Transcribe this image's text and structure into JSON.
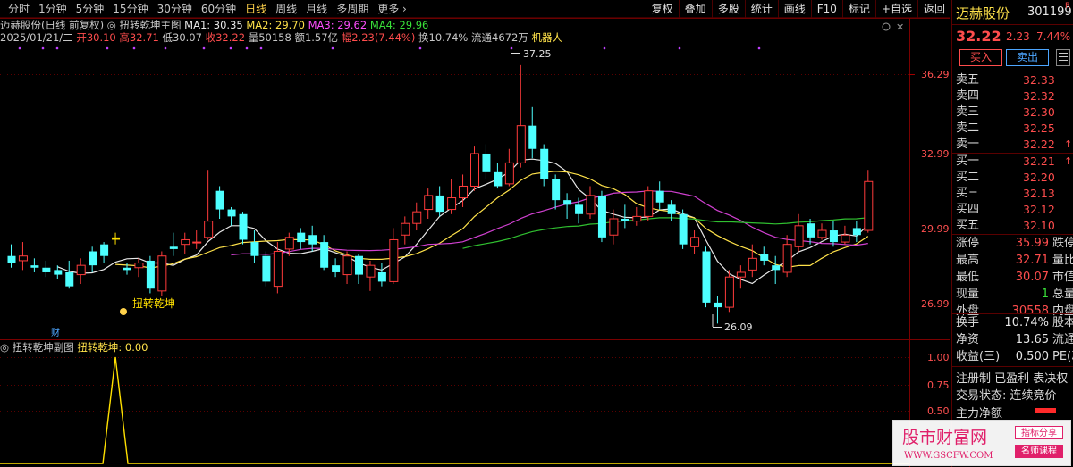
{
  "periods": [
    {
      "label": "分时",
      "active": false
    },
    {
      "label": "1分钟",
      "active": false
    },
    {
      "label": "5分钟",
      "active": false
    },
    {
      "label": "15分钟",
      "active": false
    },
    {
      "label": "30分钟",
      "active": false
    },
    {
      "label": "60分钟",
      "active": false
    },
    {
      "label": "日线",
      "active": true
    },
    {
      "label": "周线",
      "active": false
    },
    {
      "label": "月线",
      "active": false
    },
    {
      "label": "多周期",
      "active": false
    }
  ],
  "period_more": "更多 ›",
  "tools": [
    "复权",
    "叠加",
    "多股",
    "统计",
    "画线",
    "F10",
    "标记",
    "+自选",
    "返回"
  ],
  "main_header": {
    "stock": "迈赫股份(日线 前复权)",
    "indicator": "扭转乾坤主图",
    "ma1": "MA1: 30.35",
    "ma2": "MA2: 29.70",
    "ma3": "MA3: 29.62",
    "ma4": "MA4: 29.96"
  },
  "quote_line": {
    "date": "2025/01/21/二",
    "open": "开30.10",
    "high": "高32.71",
    "low": "低30.07",
    "close": "收32.22",
    "vol": "量50158",
    "amount": "额1.57亿",
    "range": "幅2.23(7.44%)",
    "turnover": "换10.74%",
    "float": "流通4672万",
    "robot": "机器人"
  },
  "price_axis": [
    "36.29",
    "32.99",
    "29.99",
    "26.99"
  ],
  "sub_axis": [
    "1.00",
    "0.75",
    "0.50"
  ],
  "annotations": {
    "high_label": "37.25",
    "low_label": "26.09",
    "signal_label": "扭转乾坤",
    "fin_marker": "财"
  },
  "sub_header": {
    "title": "扭转乾坤副图",
    "value": "扭转乾坤: 0.00"
  },
  "colors": {
    "up": "#ff3b3b",
    "down": "#4dffff",
    "ma1": "#e8e8e8",
    "ma2": "#ffe24a",
    "ma3": "#d040d0",
    "ma4": "#30c030",
    "signal": "#ffe000"
  },
  "chart_data": {
    "type": "candlestick",
    "ylim": [
      25.5,
      38.0
    ],
    "candles": [
      [
        29.0,
        28.7,
        29.5,
        28.5
      ],
      [
        28.8,
        29.0,
        29.6,
        28.4
      ],
      [
        28.6,
        28.5,
        28.9,
        28.3
      ],
      [
        28.5,
        28.3,
        28.8,
        28.1
      ],
      [
        28.4,
        28.2,
        28.6,
        28.0
      ],
      [
        28.3,
        27.7,
        28.8,
        27.6
      ],
      [
        28.2,
        28.6,
        28.9,
        27.8
      ],
      [
        29.2,
        28.6,
        29.4,
        28.3
      ],
      [
        29.5,
        29.0,
        29.6,
        28.7
      ],
      [
        29.7,
        29.8,
        30.0,
        29.5
      ],
      [
        28.5,
        28.4,
        28.7,
        28.2
      ],
      [
        28.5,
        28.7,
        28.9,
        28.1
      ],
      [
        28.8,
        27.6,
        29.0,
        27.4
      ],
      [
        27.5,
        29.0,
        29.2,
        27.3
      ],
      [
        29.4,
        29.3,
        30.0,
        29.0
      ],
      [
        29.5,
        29.7,
        30.0,
        29.1
      ],
      [
        29.6,
        29.6,
        30.1,
        29.3
      ],
      [
        29.8,
        30.5,
        32.7,
        29.7
      ],
      [
        31.8,
        31.0,
        32.0,
        30.6
      ],
      [
        31.0,
        30.7,
        31.1,
        30.3
      ],
      [
        30.8,
        29.7,
        30.9,
        29.5
      ],
      [
        29.6,
        29.0,
        30.1,
        28.7
      ],
      [
        29.0,
        27.9,
        29.2,
        27.7
      ],
      [
        27.7,
        29.2,
        29.6,
        27.4
      ],
      [
        29.3,
        29.8,
        30.0,
        29.0
      ],
      [
        30.0,
        29.6,
        30.2,
        29.3
      ],
      [
        29.9,
        29.5,
        30.3,
        29.2
      ],
      [
        29.6,
        28.5,
        29.9,
        28.4
      ],
      [
        28.6,
        28.3,
        28.9,
        28.1
      ],
      [
        28.2,
        29.0,
        29.2,
        27.8
      ],
      [
        29.0,
        28.2,
        29.1,
        27.8
      ],
      [
        28.1,
        28.6,
        28.8,
        27.5
      ],
      [
        28.3,
        27.9,
        28.7,
        27.7
      ],
      [
        27.9,
        29.7,
        30.2,
        27.8
      ],
      [
        29.9,
        30.4,
        30.7,
        29.5
      ],
      [
        30.4,
        30.9,
        31.3,
        30.1
      ],
      [
        31.0,
        31.6,
        31.9,
        30.6
      ],
      [
        31.6,
        30.9,
        32.0,
        30.7
      ],
      [
        31.0,
        31.5,
        32.3,
        30.8
      ],
      [
        31.5,
        32.0,
        32.5,
        31.1
      ],
      [
        32.0,
        33.4,
        33.7,
        31.8
      ],
      [
        33.4,
        32.6,
        33.8,
        32.3
      ],
      [
        32.6,
        32.0,
        33.0,
        31.9
      ],
      [
        32.1,
        33.0,
        33.6,
        32.0
      ],
      [
        33.0,
        34.6,
        37.2,
        32.8
      ],
      [
        34.6,
        33.6,
        35.4,
        33.2
      ],
      [
        33.6,
        32.3,
        33.8,
        32.0
      ],
      [
        32.3,
        31.4,
        32.5,
        31.0
      ],
      [
        31.4,
        31.2,
        31.7,
        30.6
      ],
      [
        31.2,
        30.8,
        31.5,
        30.4
      ],
      [
        30.8,
        31.6,
        32.0,
        30.6
      ],
      [
        31.6,
        29.8,
        31.8,
        29.6
      ],
      [
        29.9,
        30.6,
        31.0,
        29.5
      ],
      [
        30.6,
        30.5,
        31.2,
        30.2
      ],
      [
        30.5,
        30.7,
        31.1,
        30.3
      ],
      [
        30.7,
        31.8,
        32.0,
        30.5
      ],
      [
        31.8,
        31.3,
        32.2,
        31.0
      ],
      [
        31.2,
        30.8,
        31.4,
        30.5
      ],
      [
        30.8,
        29.5,
        31.0,
        29.3
      ],
      [
        29.4,
        29.8,
        30.1,
        29.1
      ],
      [
        29.2,
        27.0,
        29.4,
        26.8
      ],
      [
        27.0,
        26.8,
        27.3,
        26.1
      ],
      [
        26.8,
        28.1,
        28.4,
        26.6
      ],
      [
        28.1,
        28.3,
        28.6,
        27.6
      ],
      [
        28.4,
        28.9,
        29.5,
        28.1
      ],
      [
        29.1,
        28.8,
        29.4,
        28.6
      ],
      [
        28.6,
        28.4,
        29.0,
        27.8
      ],
      [
        28.3,
        29.5,
        29.9,
        28.1
      ],
      [
        29.4,
        30.3,
        30.8,
        29.2
      ],
      [
        30.4,
        29.8,
        30.6,
        29.5
      ],
      [
        29.8,
        30.1,
        30.4,
        29.7
      ],
      [
        30.1,
        29.6,
        30.5,
        29.4
      ],
      [
        29.6,
        29.9,
        30.3,
        29.5
      ],
      [
        30.2,
        29.9,
        30.5,
        29.6
      ],
      [
        30.1,
        32.2,
        32.7,
        30.0
      ]
    ],
    "signal_index": 9
  },
  "right_panel": {
    "name": "迈赫股份",
    "code": "301199",
    "tag": "R",
    "price": "32.22",
    "change": "2.23",
    "pct": "7.44%",
    "buy_label": "买入",
    "sell_label": "卖出",
    "asks": [
      {
        "label": "卖五",
        "price": "32.33"
      },
      {
        "label": "卖四",
        "price": "32.32"
      },
      {
        "label": "卖三",
        "price": "32.30"
      },
      {
        "label": "卖二",
        "price": "32.25"
      },
      {
        "label": "卖一",
        "price": "32.22",
        "arrow": "↑"
      }
    ],
    "bids": [
      {
        "label": "买一",
        "price": "32.21",
        "arrow": "↑"
      },
      {
        "label": "买二",
        "price": "32.20"
      },
      {
        "label": "买三",
        "price": "32.13"
      },
      {
        "label": "买四",
        "price": "32.12"
      },
      {
        "label": "买五",
        "price": "32.10"
      }
    ],
    "stats_a": [
      {
        "label": "涨停",
        "value": "35.99",
        "color": "#ff4d4d",
        "extra": "跌停"
      },
      {
        "label": "最高",
        "value": "32.71",
        "color": "#ff4d4d",
        "extra": "量比"
      },
      {
        "label": "最低",
        "value": "30.07",
        "color": "#ff4d4d",
        "extra": "市值"
      },
      {
        "label": "现量",
        "value": "1",
        "color": "#39e039",
        "extra": "总量"
      },
      {
        "label": "外盘",
        "value": "30558",
        "color": "#ff4d4d",
        "extra": "内盘"
      }
    ],
    "stats_b": [
      {
        "label": "换手",
        "value": "10.74%",
        "color": "#e8e8e8",
        "extra": "股本"
      },
      {
        "label": "净资",
        "value": "13.65",
        "color": "#e8e8e8",
        "extra": "流通"
      },
      {
        "label": "收益(三)",
        "value": "0.500",
        "color": "#e8e8e8",
        "extra": "PE(动)"
      }
    ],
    "reg": "注册制 已盈利 表决权",
    "state": "交易状态: 连续竞价",
    "money_flow": "主力净额"
  },
  "watermark": {
    "title": "股市财富网",
    "url": "WWW.GSCFW.COM",
    "tag1": "指标分享",
    "tag2": "名师课程"
  }
}
